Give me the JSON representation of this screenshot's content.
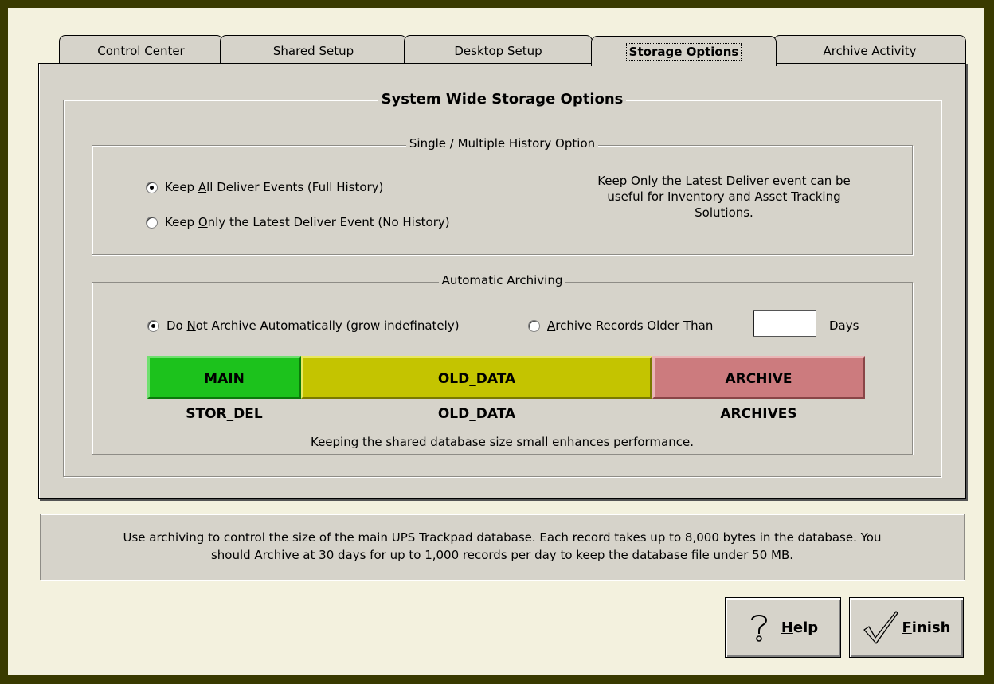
{
  "tabs": [
    {
      "label": "Control Center"
    },
    {
      "label": "Shared Setup"
    },
    {
      "label": "Desktop Setup"
    },
    {
      "label": "Storage Options"
    },
    {
      "label": "Archive Activity"
    }
  ],
  "active_tab": "Storage Options",
  "main_group": {
    "title": "System Wide Storage Options"
  },
  "history_group": {
    "title": "Single / Multiple History Option",
    "option_all": {
      "pre": "Keep ",
      "key": "A",
      "post": "ll Deliver Events (Full History)",
      "selected": true
    },
    "option_latest": {
      "pre": "Keep ",
      "key": "O",
      "post": "nly the Latest Deliver Event (No History)",
      "selected": false
    },
    "note_lines": [
      "Keep Only the Latest Deliver event can be",
      "useful for Inventory and Asset Tracking",
      "Solutions."
    ]
  },
  "archiving_group": {
    "title": "Automatic Archiving",
    "option_none": {
      "pre": "Do ",
      "key": "N",
      "post": "ot Archive Automatically (grow indefinately)",
      "selected": true
    },
    "option_older": {
      "pre": "",
      "key": "A",
      "post": "rchive Records Older Than",
      "selected": false
    },
    "days_value": "",
    "days_label": "Days",
    "bars": [
      {
        "name": "MAIN",
        "label": "STOR_DEL",
        "color": "#1cc21c"
      },
      {
        "name": "OLD_DATA",
        "label": "OLD_DATA",
        "color": "#c4c400"
      },
      {
        "name": "ARCHIVE",
        "label": "ARCHIVES",
        "color": "#cc7b7e"
      }
    ],
    "footnote": "Keeping the shared database size small enhances performance."
  },
  "info_lines": [
    "Use archiving to control the size of the main UPS Trackpad database.  Each record takes up to 8,000 bytes in the database.  You",
    "should Archive at 30 days for up to 1,000 records per day to keep the database file under 50 MB."
  ],
  "buttons": {
    "help": {
      "key": "H",
      "rest": "elp",
      "icon": "question-icon"
    },
    "finish": {
      "key": "F",
      "rest": "inish",
      "icon": "checkmark-icon"
    }
  }
}
